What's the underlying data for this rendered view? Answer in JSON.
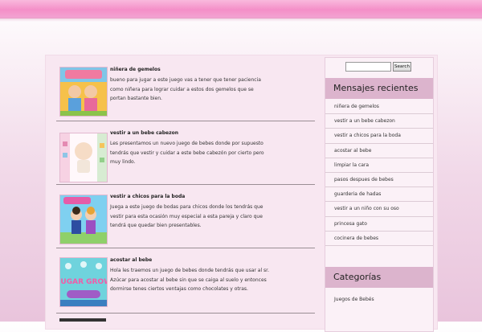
{
  "search": {
    "placeholder": "",
    "button_label": "Search"
  },
  "posts": [
    {
      "title": "niñera de gemelos",
      "text": "bueno para jugar a este juego vas a tener que tener paciencia como niñera para lograr cuidar a estos dos gemelos que se portan bastante bien."
    },
    {
      "title": "vestir a un bebe cabezon",
      "text": "Les presentamos un nuevo juego de bebes donde por supuesto tendrás que vestir y cuidar a este bebe cabezón por cierto pero muy lindo."
    },
    {
      "title": "vestir a chicos para la boda",
      "text": "Juega a este juego de bodas para chicos donde los tendrás que vestir para esta ocasión muy especial a esta pareja y claro que tendrá que quedar bien presentables."
    },
    {
      "title": "acostar al bebe",
      "text": "Hola les traemos un juego de bebes donde tendrás que usar al sr. Azúcar para acostar al bebe sin que se caiga al suelo y entonces dormirse tenes ciertos ventajas como chocolates y otras."
    }
  ],
  "thumbs": {
    "post4_text": "SUGAR GROW"
  },
  "sidebar": {
    "recent_title": "Mensajes recientes",
    "recent_items": [
      "niñera de gemelos",
      "vestir a un bebe cabezon",
      "vestir a chicos para la boda",
      "acostar al bebe",
      "limpiar la cara",
      "pasos despues de bebes",
      "guarderia de hadas",
      "vestir a un niño con su oso",
      "princesa gato",
      "cocinera de bebes"
    ],
    "categories_title": "Categorías",
    "categories": [
      "Juegos de Bebés"
    ]
  },
  "colors": {
    "accent_pink": "#f48fc8",
    "widget_header": "#dcb4cd"
  }
}
